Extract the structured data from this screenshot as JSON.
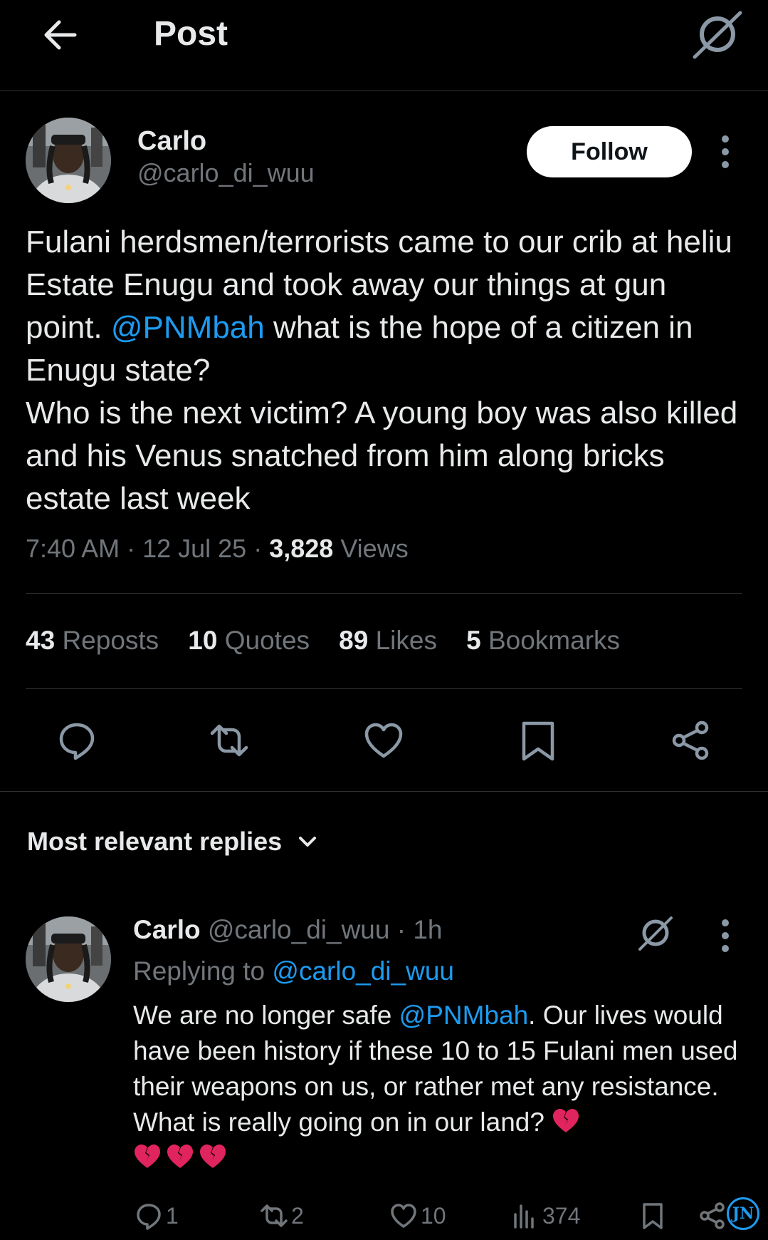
{
  "header": {
    "title": "Post",
    "back_icon": "arrow-left-icon",
    "grok_icon": "grok-icon"
  },
  "post": {
    "author_name": "Carlo",
    "author_handle": "@carlo_di_wuu",
    "follow_label": "Follow",
    "text_1": "Fulani herdsmen/terrorists came to our crib at heliu Estate Enugu and took away our things at gun point. ",
    "mention": "@PNMbah",
    "text_2": " what is the hope of a citizen in Enugu state?",
    "text_3": "Who is the next victim? A young boy was also killed and his Venus snatched from him along bricks estate last week",
    "time": "7:40 AM",
    "date": "12 Jul 25",
    "views_count": "3,828",
    "views_label": "Views"
  },
  "stats": [
    {
      "count": "43",
      "label": "Reposts"
    },
    {
      "count": "10",
      "label": "Quotes"
    },
    {
      "count": "89",
      "label": "Likes"
    },
    {
      "count": "5",
      "label": "Bookmarks"
    }
  ],
  "actions": [
    "reply-icon",
    "repost-icon",
    "like-icon",
    "bookmark-icon",
    "share-icon"
  ],
  "replies_filter": {
    "label": "Most relevant replies"
  },
  "reply": {
    "author_name": "Carlo",
    "author_handle": "@carlo_di_wuu",
    "time": "1h",
    "replying_prefix": "Replying to ",
    "replying_to": "@carlo_di_wuu",
    "text_1": "We are no longer safe ",
    "mention": "@PNMbah",
    "text_2": ". Our lives would have been history if these 10 to 15 Fulani men used their weapons on us, or rather met any resistance. What is really going on in our land? ",
    "replies": "1",
    "reposts": "2",
    "likes": "10",
    "views": "374"
  },
  "watermark": {
    "text": "JN"
  },
  "colors": {
    "background": "#000000",
    "text": "#e7e9ea",
    "muted": "#71767b",
    "link": "#1d9bf0",
    "divider": "#2f3336",
    "heart": "#e0245e"
  }
}
